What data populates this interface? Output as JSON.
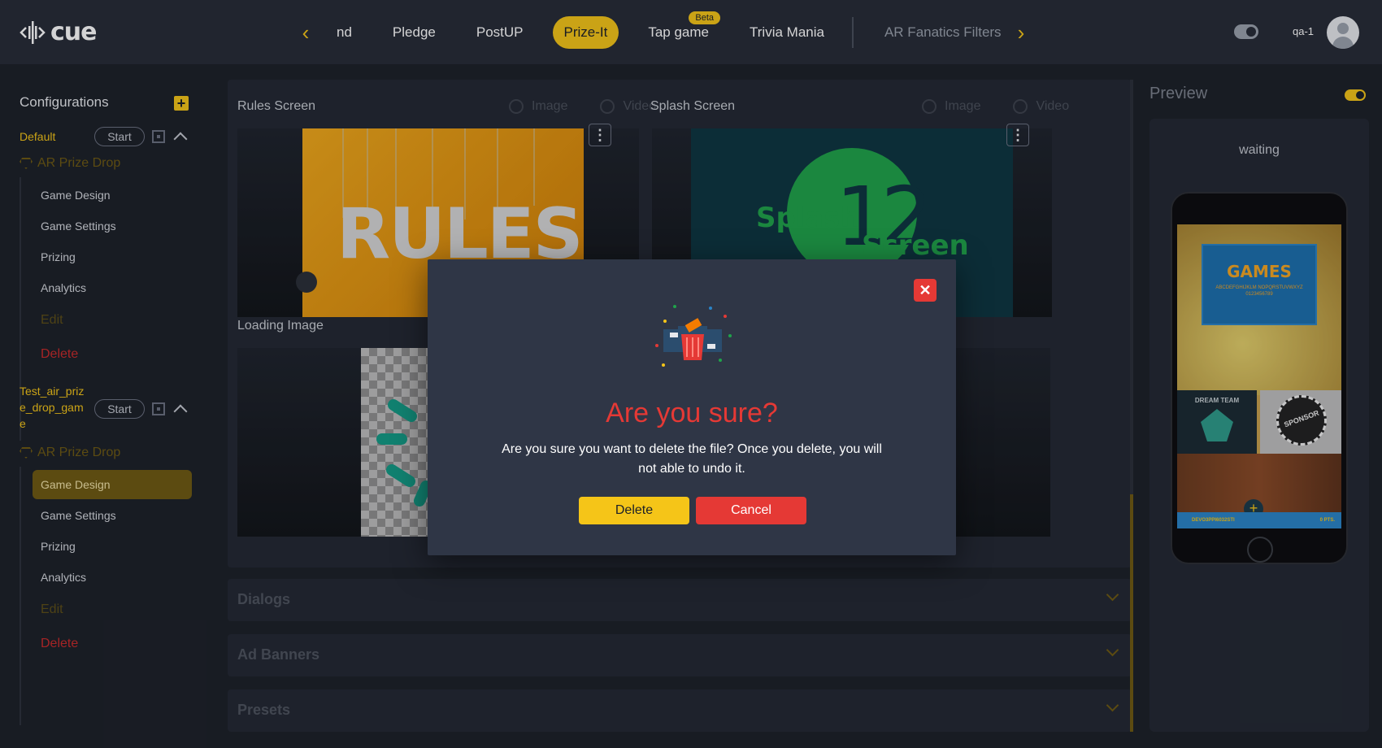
{
  "app": {
    "logo_text": "cue"
  },
  "topnav": {
    "tabs": [
      {
        "label": "nd",
        "state": "normal"
      },
      {
        "label": "Pledge",
        "state": "normal"
      },
      {
        "label": "PostUP",
        "state": "normal"
      },
      {
        "label": "Prize-It",
        "state": "active"
      },
      {
        "label": "Tap game",
        "state": "normal",
        "badge": "Beta"
      },
      {
        "label": "Trivia Mania",
        "state": "normal"
      },
      {
        "label": "AR Fanatics Filters",
        "state": "muted"
      }
    ],
    "prev_icon": "chevron-left-icon",
    "next_icon": "chevron-right-icon",
    "user_name": "qa-1"
  },
  "sidebar": {
    "heading": "Configurations",
    "configs": [
      {
        "name": "Default",
        "start_label": "Start",
        "product": "AR Prize Drop",
        "items": [
          "Game Design",
          "Game Settings",
          "Prizing",
          "Analytics"
        ],
        "edit_label": "Edit",
        "delete_label": "Delete"
      },
      {
        "name": "Test_air_priz e_drop_gam e",
        "start_label": "Start",
        "product": "AR Prize Drop",
        "items": [
          "Game Design",
          "Game Settings",
          "Prizing",
          "Analytics"
        ],
        "active_item": "Game Design",
        "edit_label": "Edit",
        "delete_label": "Delete"
      }
    ]
  },
  "main": {
    "rules_screen": {
      "title": "Rules Screen",
      "option_image": "Image",
      "option_video": "Video",
      "preview_text": "RULES"
    },
    "splash_screen": {
      "title": "Splash Screen",
      "option_image": "Image",
      "option_video": "Video",
      "preview_text_left": "Splash",
      "preview_text_right": "Screen",
      "preview_number": "12"
    },
    "loading_image": {
      "title": "Loading Image"
    },
    "accordions": [
      "Dialogs",
      "Ad Banners",
      "Presets"
    ]
  },
  "preview": {
    "title": "Preview",
    "status": "waiting",
    "phone": {
      "banner_title": "GAMES",
      "banner_sub": "ABCDEFGHIJKLM NOPQRSTUVWXYZ 0123456789",
      "tile_left": "DREAM TEAM",
      "tile_right": "SPONSOR",
      "footer_code": "DEVO3PPI6032STI",
      "footer_pts": "0 PTS."
    }
  },
  "modal": {
    "title": "Are you sure?",
    "message": "Are you sure you want to delete the file? Once you delete, you will not able to undo it.",
    "delete_label": "Delete",
    "cancel_label": "Cancel",
    "close_icon": "close-icon",
    "colors": {
      "danger": "#e53935",
      "accent": "#f5c518"
    }
  }
}
